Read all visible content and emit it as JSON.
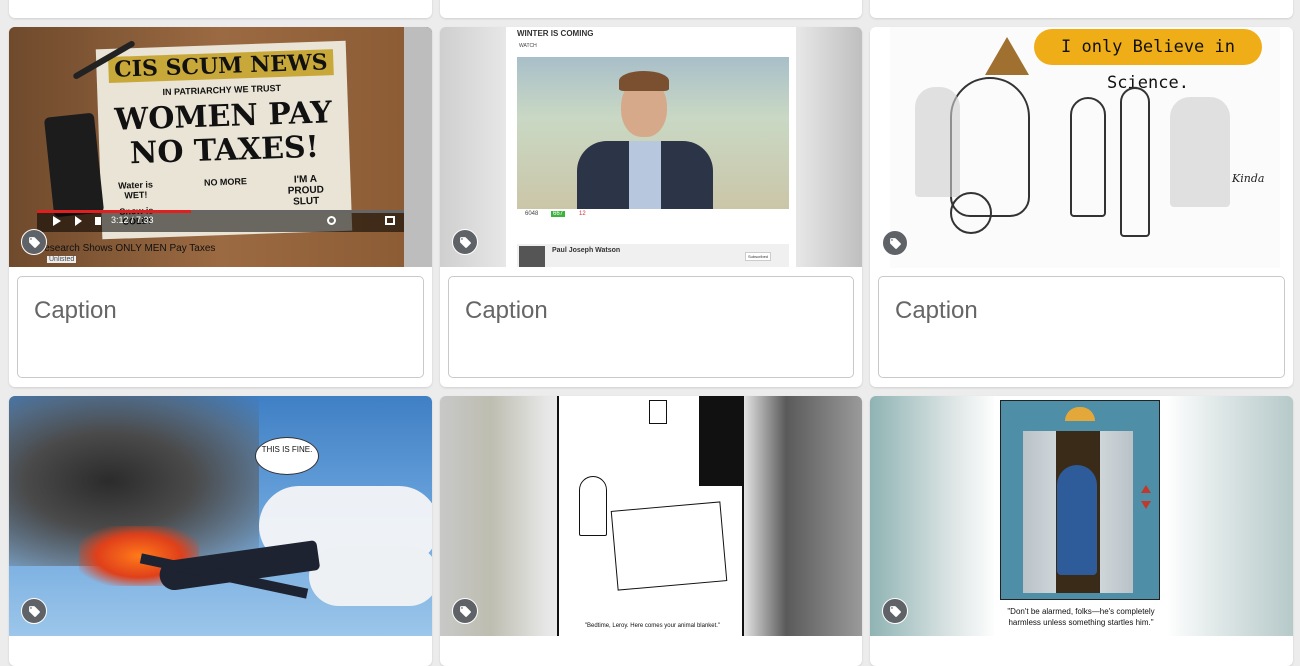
{
  "cards": [
    {
      "caption_placeholder": "Caption",
      "video_title": "Research Shows ONLY MEN Pay Taxes",
      "video_status": "Unlisted",
      "video_time": "3:12 / 7:33",
      "newspaper_masthead": "CIS SCUM NEWS",
      "newspaper_motto": "IN PATRIARCHY WE TRUST",
      "headline_1": "WOMEN PAY",
      "headline_2": "NO TAXES!",
      "sub_1": "Water is WET!",
      "sub_2": "NO MORE",
      "sub_3": "I'M A PROUD SLUT",
      "sub_4": "Snow is COLD!"
    },
    {
      "caption_placeholder": "Caption",
      "video_title": "WINTER IS COMING",
      "watch_label": "WATCH",
      "channel_name": "Paul Joseph Watson",
      "subscribed_label": "Subscribed",
      "views": "6048",
      "likes": "667",
      "dislikes": "12"
    },
    {
      "caption_placeholder": "Caption",
      "speech_bubble": "I only Believe in Science.",
      "signature": "Kinda"
    },
    {
      "speech_bubble": "THIS IS FINE."
    },
    {
      "cartoon_caption": "\"Bedtime, Leroy. Here comes your animal blanket.\""
    },
    {
      "cartoon_caption": "\"Don't be alarmed, folks—he's completely harmless unless something startles him.\""
    }
  ],
  "colors": {
    "page_bg": "#ececec",
    "card_bg": "#ffffff",
    "tag_button": "#5f6368",
    "caption_text": "#666666"
  },
  "icons": {
    "tag": "tag-icon"
  }
}
